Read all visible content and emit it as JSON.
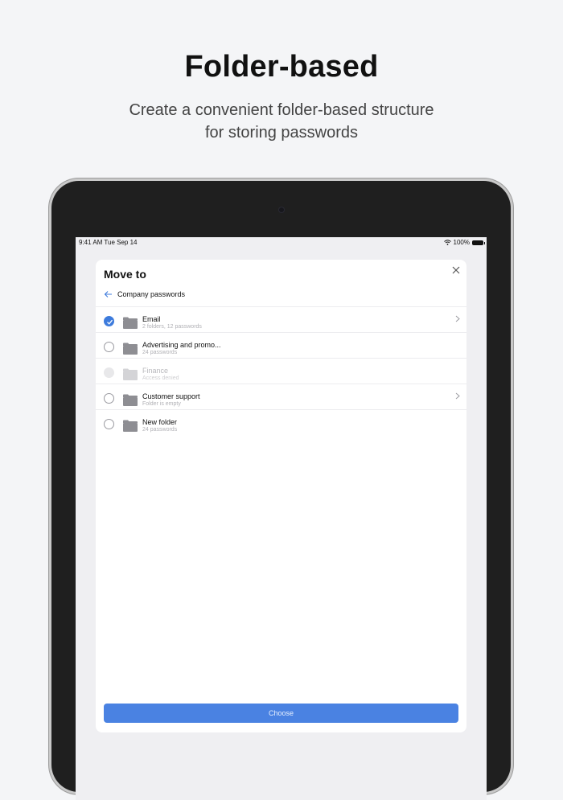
{
  "promo": {
    "title": "Folder-based",
    "subtitle_line1": "Create a convenient folder-based structure",
    "subtitle_line2": "for storing passwords"
  },
  "statusbar": {
    "time": "9:41 AM   Tue Sep 14",
    "battery": "100%"
  },
  "sheet": {
    "title": "Move to",
    "breadcrumb": "Company passwords",
    "choose_label": "Choose"
  },
  "folders": [
    {
      "name": "Email",
      "detail": "2 folders, 12 passwords",
      "state": "checked",
      "has_children": true
    },
    {
      "name": "Advertising and promo...",
      "detail": "24 passwords",
      "state": "unchecked",
      "has_children": false
    },
    {
      "name": "Finance",
      "detail": "Access denied",
      "state": "disabled",
      "has_children": false
    },
    {
      "name": "Customer support",
      "detail": "Folder is empty",
      "state": "unchecked",
      "has_children": true
    },
    {
      "name": "New folder",
      "detail": "24 passwords",
      "state": "unchecked",
      "has_children": false
    }
  ],
  "colors": {
    "accent": "#3d7bdc",
    "button": "#4a82e2",
    "background": "#f4f5f7"
  }
}
